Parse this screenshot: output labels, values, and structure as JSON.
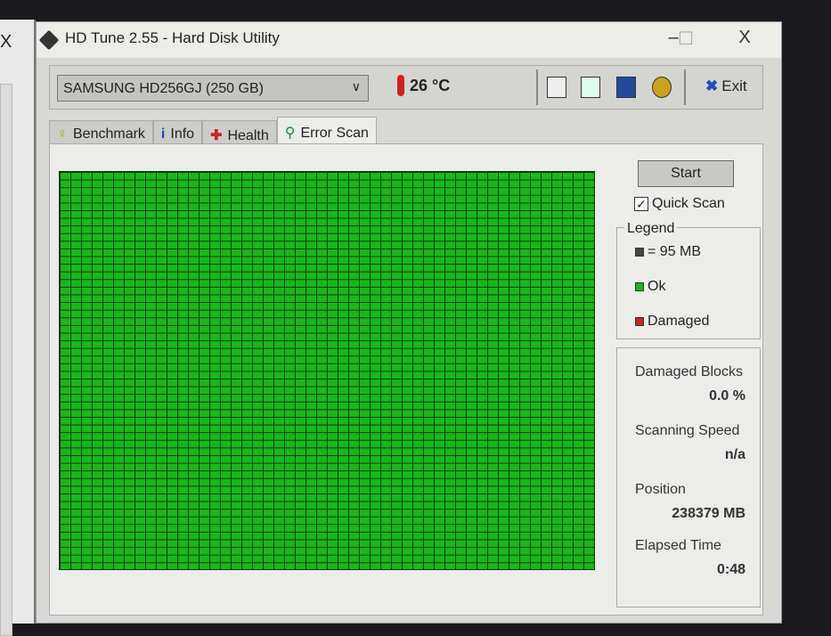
{
  "window": {
    "title": "HD Tune 2.55 - Hard Disk Utility",
    "minimize": "–",
    "maximize": "☐",
    "close": "X"
  },
  "background_window": {
    "close": "X"
  },
  "toolbar": {
    "drive": "SAMSUNG HD256GJ (250 GB)",
    "temperature": "26 °C",
    "exit_label": "Exit"
  },
  "tabs": [
    {
      "label": "Benchmark",
      "icon": "bulb-icon"
    },
    {
      "label": "Info",
      "icon": "info-icon"
    },
    {
      "label": "Health",
      "icon": "health-cross-icon"
    },
    {
      "label": "Error Scan",
      "icon": "magnifier-icon",
      "active": true
    }
  ],
  "scan": {
    "start_label": "Start",
    "quick_scan_label": "Quick Scan",
    "quick_scan_checked": true,
    "legend": {
      "title": "Legend",
      "block": "= 95 MB",
      "ok": "Ok",
      "damaged": "Damaged"
    },
    "colors": {
      "ok": "#18b818",
      "damaged": "#cc2222",
      "block": "#444444"
    },
    "stats": {
      "damaged_label": "Damaged Blocks",
      "damaged_value": "0.0 %",
      "speed_label": "Scanning Speed",
      "speed_value": "n/a",
      "position_label": "Position",
      "position_value": "238379 MB",
      "elapsed_label": "Elapsed Time",
      "elapsed_value": "0:48"
    }
  }
}
